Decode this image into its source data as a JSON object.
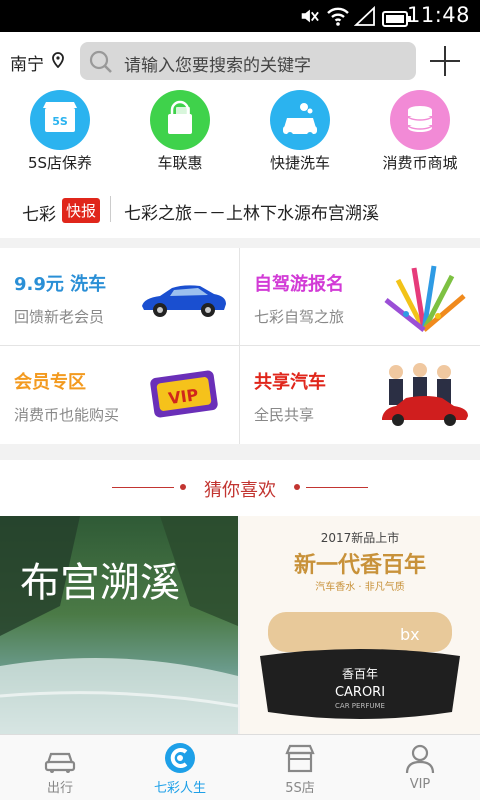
{
  "status_bar": {
    "time": "11:48"
  },
  "header": {
    "city": "南宁",
    "search_placeholder": "请输入您要搜索的关键字"
  },
  "quick_menu": [
    {
      "label": "5S店保养",
      "icon": "5s-store-icon",
      "color": "#2bb3ef",
      "icon_text": "5S"
    },
    {
      "label": "车联惠",
      "icon": "shopping-bag-icon",
      "color": "#3fd24b"
    },
    {
      "label": "快捷洗车",
      "icon": "car-wash-icon",
      "color": "#2bb3ef"
    },
    {
      "label": "消费币商城",
      "icon": "coins-icon",
      "color": "#f28ad6"
    }
  ],
  "news": {
    "brand": "七彩",
    "badge": "快报",
    "headline": "七彩之旅－－上林下水源布宫溯溪"
  },
  "promos": [
    {
      "title": "9.9元 洗车",
      "subtitle": "回馈新老会员",
      "title_color": "#2a8fd6",
      "image": "blue-car-image"
    },
    {
      "title": "自驾游报名",
      "subtitle": "七彩自驾之旅",
      "title_color": "#d23bd6",
      "image": "fireworks-image"
    },
    {
      "title": "会员专区",
      "subtitle": "消费币也能购买",
      "title_color": "#f39a1f",
      "image": "vip-promo-image",
      "image_text": "VIP"
    },
    {
      "title": "共享汽车",
      "subtitle": "全民共享",
      "title_color": "#e0261b",
      "image": "shared-car-people-image"
    }
  ],
  "guess_section": {
    "title": "猜你喜欢"
  },
  "products": {
    "left": {
      "text": "布宫溯溪"
    },
    "right": {
      "tagline": "2017新品上市",
      "title": "新一代香百年",
      "subtitle": "汽车香水 · 非凡气质",
      "badge": "bx",
      "brand_cn": "香百年",
      "brand": "CARORI",
      "brand_sub": "CAR PERFUME"
    }
  },
  "tabs": [
    {
      "label": "出行",
      "icon": "car-icon",
      "active": false
    },
    {
      "label": "七彩人生",
      "icon": "qicai-logo-icon",
      "active": true
    },
    {
      "label": "5S店",
      "icon": "store-icon",
      "active": false
    },
    {
      "label": "VIP",
      "icon": "person-icon",
      "active": false
    }
  ],
  "colors": {
    "accent": "#1ea0e8",
    "red": "#e0261b",
    "guess": "#c23531"
  }
}
